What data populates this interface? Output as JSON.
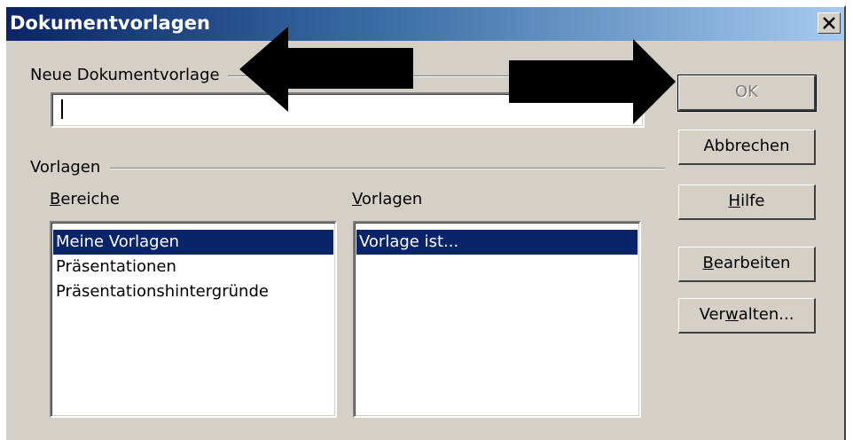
{
  "dialog": {
    "title": "Dokumentvorlagen",
    "close_symbol": "×"
  },
  "new_template": {
    "group_label": "Neue Dokumentvorlage",
    "input_value": ""
  },
  "templates": {
    "group_label": "Vorlagen",
    "categories_label": {
      "mnemonic": "B",
      "rest": "ereiche"
    },
    "templates_label": {
      "mnemonic": "V",
      "rest": "orlagen"
    },
    "categories": [
      {
        "label": "Meine Vorlagen",
        "selected": true
      },
      {
        "label": "Präsentationen",
        "selected": false
      },
      {
        "label": "Präsentationshintergründe",
        "selected": false
      }
    ],
    "template_items": [
      {
        "label": "Vorlage ist...",
        "selected": true
      }
    ]
  },
  "buttons": {
    "ok": {
      "label": "OK",
      "enabled": false
    },
    "cancel": {
      "label": "Abbrechen"
    },
    "help": {
      "mnemonic": "H",
      "rest": "ilfe"
    },
    "edit": {
      "mnemonic": "B",
      "rest": "earbeiten"
    },
    "manage": {
      "before": "Ver",
      "mnemonic": "w",
      "after": "alten..."
    }
  },
  "annotations": {
    "arrow_color": "#000000",
    "arrows": [
      "left-arrow",
      "right-arrow"
    ]
  },
  "colors": {
    "title_gradient_start": "#0a246a",
    "title_gradient_end": "#a6caf0",
    "selection": "#0a246a",
    "dialog_face": "#d4d0c8"
  }
}
